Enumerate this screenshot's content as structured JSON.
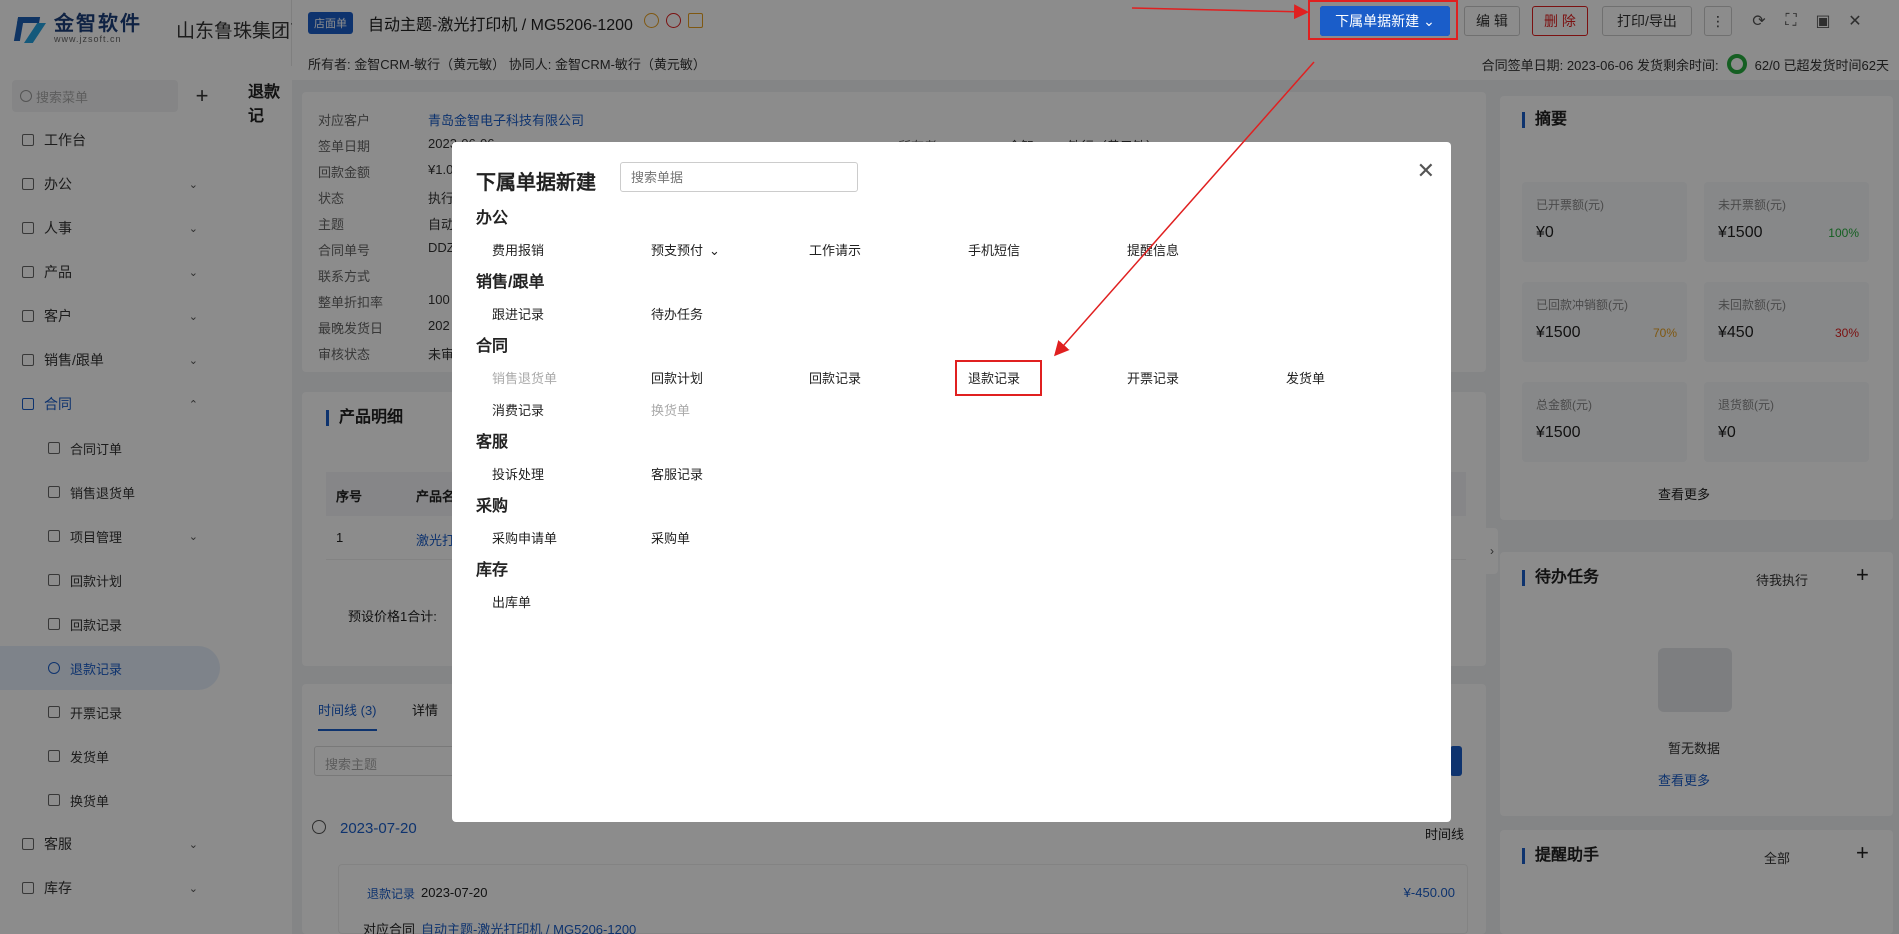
{
  "sidebar": {
    "logo_cn": "金智软件",
    "logo_url": "www.jzsoft.cn",
    "company": "山东鲁珠集团商",
    "search_placeholder": "搜索菜单",
    "items": [
      {
        "label": "工作台"
      },
      {
        "label": "办公"
      },
      {
        "label": "人事"
      },
      {
        "label": "产品"
      },
      {
        "label": "客户"
      },
      {
        "label": "销售/跟单"
      },
      {
        "label": "合同"
      },
      {
        "label": "合同订单"
      },
      {
        "label": "销售退货单"
      },
      {
        "label": "项目管理"
      },
      {
        "label": "回款计划"
      },
      {
        "label": "回款记录"
      },
      {
        "label": "退款记录"
      },
      {
        "label": "开票记录"
      },
      {
        "label": "发货单"
      },
      {
        "label": "换货单"
      },
      {
        "label": "客服"
      },
      {
        "label": "库存"
      }
    ]
  },
  "header": {
    "tag": "店面单",
    "title": "自动主题-激光打印机 / MG5206-1200",
    "owner_line": "所有者: 金智CRM-敏行（黄元敏）  协同人: 金智CRM-敏行（黄元敏）",
    "sign_date": "合同签单日期: 2023-06-06  发货剩余时间:",
    "progress_text": "62/0  已超发货时间62天",
    "buttons": {
      "new_child": "下属单据新建",
      "edit": "编 辑",
      "delete": "删 除",
      "print": "打印/导出"
    }
  },
  "list_bg": {
    "tab": "退款记"
  },
  "detail": {
    "labels": [
      "对应客户",
      "签单日期",
      "回款金额",
      "状态",
      "主题",
      "合同单号",
      "联系方式",
      "整单折扣率",
      "最晚发货日",
      "审核状态"
    ],
    "values": [
      "青岛金智电子科技有限公司",
      "2023-06-06",
      "¥1.0",
      "执行",
      "自动",
      "DDZ",
      "",
      "100",
      "202",
      "未审"
    ],
    "right_label": "所有者",
    "right_value": "金智CRM-敏行（黄元敏）"
  },
  "products": {
    "title": "产品明细",
    "col_no": "序号",
    "col_name": "产品名",
    "row_no": "1",
    "row_name": "激光打",
    "total": "预设价格1合计:"
  },
  "timeline": {
    "tab_timeline": "时间线 (3)",
    "tab_detail": "详情",
    "search_placeholder": "搜索主题",
    "date": "2023-07-20",
    "view_label": "时间线",
    "entry_type": "退款记录",
    "entry_date": "2023-07-20",
    "entry_amount": "¥-450.00",
    "entry_contract_label": "对应合同",
    "entry_contract": "自动主题-激光打印机 / MG5206-1200"
  },
  "summary": {
    "title": "摘要",
    "stats": [
      {
        "label": "已开票额(元)",
        "value": "¥0",
        "pct": ""
      },
      {
        "label": "未开票额(元)",
        "value": "¥1500",
        "pct": "100%"
      },
      {
        "label": "已回款冲销额(元)",
        "value": "¥1500",
        "pct": "70%"
      },
      {
        "label": "未回款额(元)",
        "value": "¥450",
        "pct": "30%"
      },
      {
        "label": "总金额(元)",
        "value": "¥1500",
        "pct": ""
      },
      {
        "label": "退货额(元)",
        "value": "¥0",
        "pct": ""
      }
    ],
    "more": "查看更多"
  },
  "todo": {
    "title": "待办任务",
    "filter": "待我执行",
    "empty": "暂无数据",
    "more": "查看更多"
  },
  "reminder": {
    "title": "提醒助手",
    "filter": "全部"
  },
  "modal": {
    "title": "下属单据新建",
    "search_placeholder": "搜索单据",
    "groups": [
      {
        "name": "办公",
        "items": [
          "费用报销",
          "预支预付",
          "工作请示",
          "手机短信",
          "提醒信息"
        ]
      },
      {
        "name": "销售/跟单",
        "items": [
          "跟进记录",
          "待办任务"
        ]
      },
      {
        "name": "合同",
        "items": [
          "销售退货单",
          "回款计划",
          "回款记录",
          "退款记录",
          "开票记录",
          "发货单",
          "消费记录",
          "换货单"
        ]
      },
      {
        "name": "客服",
        "items": [
          "投诉处理",
          "客服记录"
        ]
      },
      {
        "name": "采购",
        "items": [
          "采购申请单",
          "采购单"
        ]
      },
      {
        "name": "库存",
        "items": [
          "出库单"
        ]
      }
    ]
  },
  "colors": {
    "accent": "#1a5dc9",
    "danger": "#e02020",
    "success": "#27ae3e",
    "warning": "#e8a020"
  }
}
